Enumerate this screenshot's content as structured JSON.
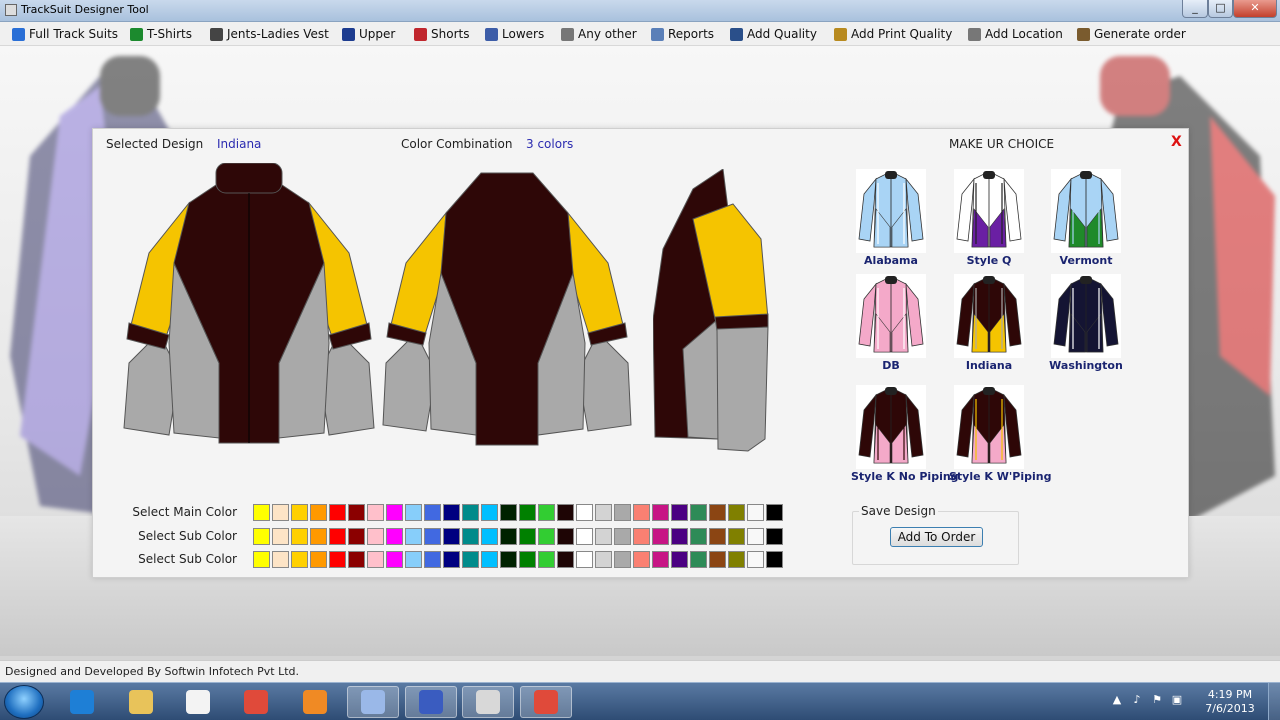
{
  "window": {
    "title": "TrackSuit Designer Tool",
    "min": "_",
    "max": "□",
    "close": "✕"
  },
  "menu": [
    {
      "label": "Full Track Suits",
      "icon": "pin-icon",
      "color": "#2a6fd6"
    },
    {
      "label": "T-Shirts",
      "icon": "tshirt-icon",
      "color": "#1c8a2e"
    },
    {
      "label": "Jents-Ladies Vest",
      "icon": "vest-icon",
      "color": "#444444"
    },
    {
      "label": "Upper",
      "icon": "jacket-icon",
      "color": "#1d3c8f"
    },
    {
      "label": "Shorts",
      "icon": "shorts-icon",
      "color": "#c0262d"
    },
    {
      "label": "Lowers",
      "icon": "pants-icon",
      "color": "#3d5da8"
    },
    {
      "label": "Any other",
      "icon": "paint-icon",
      "color": "#777777"
    },
    {
      "label": "Reports",
      "icon": "report-icon",
      "color": "#5a7fb8"
    },
    {
      "label": "Add Quality",
      "icon": "monitor-icon",
      "color": "#2a4f8a"
    },
    {
      "label": "Add Print Quality",
      "icon": "print-icon",
      "color": "#b88a1f"
    },
    {
      "label": "Add Location",
      "icon": "location-icon",
      "color": "#777777"
    },
    {
      "label": "Generate order",
      "icon": "order-icon",
      "color": "#7a5b2e"
    }
  ],
  "panel": {
    "selected_design_label": "Selected Design",
    "selected_design_value": "Indiana",
    "color_combination_label": "Color Combination",
    "color_combination_value": "3 colors",
    "choice_title": "MAKE UR CHOICE",
    "close_label": "X"
  },
  "design_colors": {
    "main": "#2e0707",
    "sub1": "#f5c400",
    "sub2": "#a9a9a9"
  },
  "styles": [
    {
      "name": "Alabama",
      "body": "#a9d4f5",
      "accent": "#a9d4f5",
      "trim": "#ffffff"
    },
    {
      "name": "Style Q",
      "body": "#ffffff",
      "accent": "#6a1fa3",
      "trim": "#222222"
    },
    {
      "name": "Vermont",
      "body": "#a9d4f5",
      "accent": "#1f8a2a",
      "trim": "#a9d4f5"
    },
    {
      "name": "DB",
      "body": "#f4a9c9",
      "accent": "#f4a9c9",
      "trim": "#ffffff"
    },
    {
      "name": "Indiana",
      "body": "#2e0707",
      "accent": "#f5c400",
      "trim": "#a9a9a9"
    },
    {
      "name": "Washington",
      "body": "#141433",
      "accent": "#141433",
      "trim": "#ffffff"
    },
    {
      "name": "Style K No Piping",
      "body": "#2e0707",
      "accent": "#f4a9c9",
      "trim": "#2e0707"
    },
    {
      "name": "Style K W'Piping",
      "body": "#2e0707",
      "accent": "#f4a9c9",
      "trim": "#f5c400"
    }
  ],
  "color_rows": [
    {
      "label": "Select Main Color"
    },
    {
      "label": "Select Sub Color"
    },
    {
      "label": "Select Sub Color"
    }
  ],
  "palette": [
    "#ffff00",
    "#fde4c6",
    "#ffd000",
    "#ff9900",
    "#ff0000",
    "#8b0000",
    "#ffc0cb",
    "#ff00ff",
    "#87cefa",
    "#4169e1",
    "#000080",
    "#008b8b",
    "#00bfff",
    "#002200",
    "#008000",
    "#32cd32",
    "#1e0505",
    "#ffffff",
    "#d3d3d3",
    "#a9a9a9",
    "#fa8072",
    "#c71585",
    "#4b0082",
    "#2e8b57",
    "#8b4513",
    "#808000",
    "#f8f8f8",
    "#000000"
  ],
  "save": {
    "legend": "Save Design",
    "button": "Add To Order"
  },
  "status": "Designed and Developed By Softwin Infotech Pvt Ltd.",
  "taskbar": {
    "apps": [
      "ie-icon",
      "explorer-icon",
      "media-player-icon",
      "chrome-icon",
      "firefox-icon",
      "network-icon",
      "infinity-icon",
      "window-icon",
      "designer-app-icon"
    ],
    "time": "4:19 PM",
    "date": "7/6/2013"
  }
}
